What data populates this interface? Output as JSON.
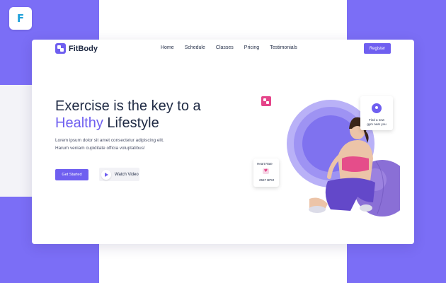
{
  "app_icon": {
    "letter": "F",
    "color": "#1fa1d9"
  },
  "colors": {
    "accent": "#6f5ff0",
    "background_block": "#7b6ef6",
    "pink": "#e5458a"
  },
  "brand": {
    "name": "FitBody"
  },
  "nav": {
    "items": [
      {
        "label": "Home"
      },
      {
        "label": "Schedule"
      },
      {
        "label": "Classes"
      },
      {
        "label": "Pricing"
      },
      {
        "label": "Testimonials"
      }
    ],
    "register_label": "Register"
  },
  "hero": {
    "headline_line1": "Exercise is the key to a",
    "headline_accent": "Healthy",
    "headline_rest": " Lifestyle",
    "subtext_line1": "Lorem ipsum dolor sit amet consectetur adipiscing elit.",
    "subtext_line2": "Harum veniam cupiditate officia voluptatibus!",
    "cta_label": "Get Started",
    "video_label": "Watch Video"
  },
  "heart_card": {
    "title": "Heart Rate",
    "value": "2567 BPM"
  },
  "gym_card": {
    "line1": "Find a new",
    "line2": "gym near you"
  }
}
